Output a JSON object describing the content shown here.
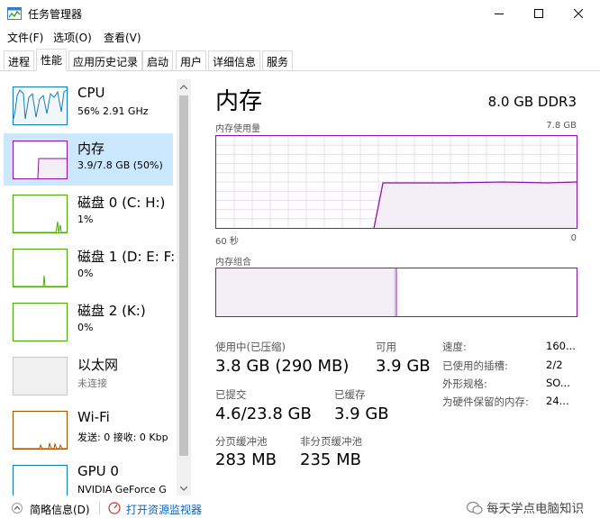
{
  "window": {
    "title": "任务管理器",
    "controls": {
      "minimize": "minimize",
      "maximize": "maximize",
      "close": "close"
    }
  },
  "menu": [
    "文件(F)",
    "选项(O)",
    "查看(V)"
  ],
  "tabs": [
    {
      "label": "进程",
      "active": false
    },
    {
      "label": "性能",
      "active": true
    },
    {
      "label": "应用历史记录",
      "active": false
    },
    {
      "label": "启动",
      "active": false
    },
    {
      "label": "用户",
      "active": false
    },
    {
      "label": "详细信息",
      "active": false
    },
    {
      "label": "服务",
      "active": false
    }
  ],
  "devices": [
    {
      "name": "CPU",
      "sub": "56%  2.91 GHz",
      "graph_color": "#117dbb",
      "selected": false
    },
    {
      "name": "内存",
      "sub": "3.9/7.8 GB (50%)",
      "graph_color": "#8b12ae",
      "selected": true
    },
    {
      "name": "磁盘 0 (C: H:)",
      "sub": "1%",
      "graph_color": "#4da60c",
      "selected": false
    },
    {
      "name": "磁盘 1 (D: E: F:",
      "sub": "0%",
      "graph_color": "#4da60c",
      "selected": false
    },
    {
      "name": "磁盘 2 (K:)",
      "sub": "0%",
      "graph_color": "#4da60c",
      "selected": false
    },
    {
      "name": "以太网",
      "sub": "未连接",
      "graph_color": "#a74f01",
      "selected": false
    },
    {
      "name": "Wi-Fi",
      "sub": "发送: 0 接收: 0 Kbp",
      "graph_color": "#a74f01",
      "selected": false
    },
    {
      "name": "GPU 0",
      "sub": "NVIDIA GeForce G",
      "graph_color": "#117dbb",
      "selected": false
    }
  ],
  "detail": {
    "title": "内存",
    "spec": "8.0 GB DDR3",
    "usage_label": "内存使用量",
    "usage_max": "7.8 GB",
    "x_left": "60 秒",
    "x_right": "0",
    "composition_label": "内存组合",
    "accent_color": "#8b12ae",
    "fill_color": "#f4eef7",
    "usage_fraction": 0.5,
    "stats": {
      "in_use_label": "使用中(已压缩)",
      "in_use_value": "3.8 GB (290 MB)",
      "available_label": "可用",
      "available_value": "3.9 GB",
      "committed_label": "已提交",
      "committed_value": "4.6/23.8 GB",
      "cached_label": "已缓存",
      "cached_value": "3.9 GB",
      "paged_label": "分页缓冲池",
      "paged_value": "283 MB",
      "nonpaged_label": "非分页缓冲池",
      "nonpaged_value": "235 MB"
    },
    "properties": [
      {
        "label": "速度:",
        "value": "160..."
      },
      {
        "label": "已使用的插槽:",
        "value": "2/2"
      },
      {
        "label": "外形规格:",
        "value": "SO..."
      },
      {
        "label": "为硬件保留的内存:",
        "value": "24..."
      }
    ]
  },
  "bottom": {
    "summary": "简略信息(D)",
    "open_monitor": "打开资源监视器"
  },
  "watermark": "每天学点电脑知识"
}
